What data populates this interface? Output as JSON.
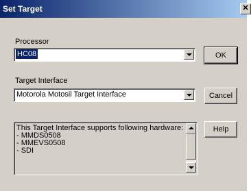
{
  "window": {
    "title": "Set Target",
    "close_glyph": "✕"
  },
  "processor": {
    "label": "Processor",
    "value": "HC08"
  },
  "target_interface": {
    "label": "Target Interface",
    "value": "Motorola Motosil Target Interface"
  },
  "buttons": {
    "ok": "OK",
    "cancel": "Cancel",
    "help": "Help"
  },
  "hardware_info": {
    "lines": [
      "This Target Interface supports following hardware:",
      "- MMDS0508",
      "- MMEVS0508",
      "- SDI"
    ]
  },
  "colors": {
    "dialog_bg": "#d4d0c8",
    "titlebar_start": "#0a246a",
    "titlebar_end": "#a6caf0",
    "selection": "#0a246a"
  },
  "icons": [
    "close-icon",
    "dropdown-arrow-icon",
    "scroll-up-icon",
    "scroll-down-icon"
  ]
}
